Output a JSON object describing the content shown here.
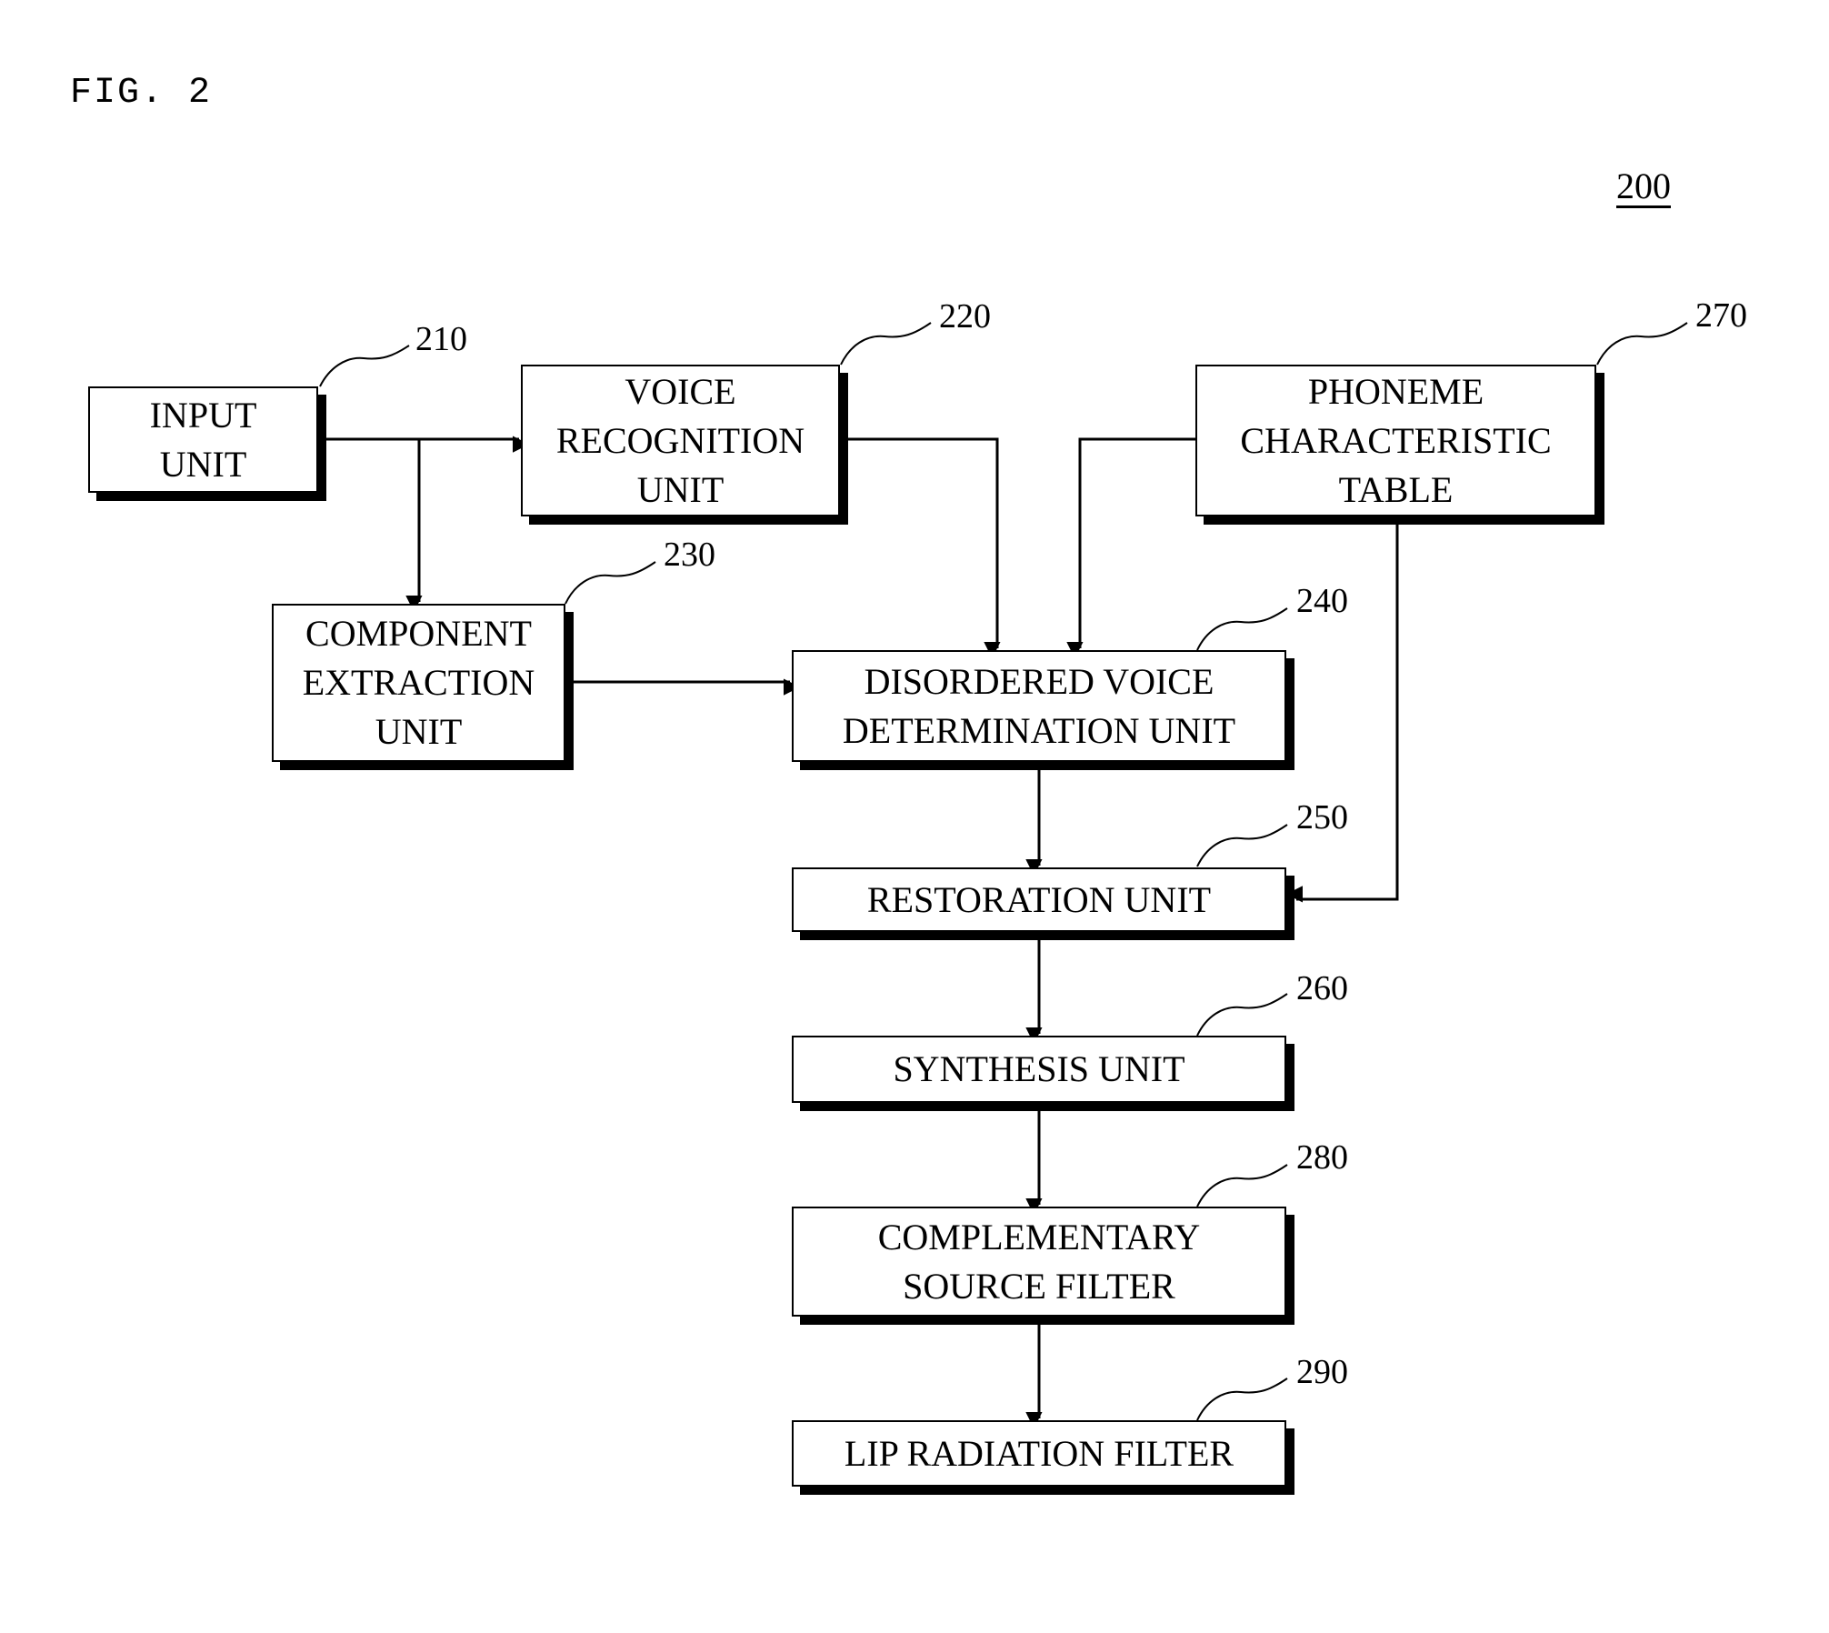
{
  "figure": {
    "title": "FIG. 2",
    "reference": "200"
  },
  "blocks": {
    "input": {
      "label": "INPUT\nUNIT",
      "ref": "210"
    },
    "voice_recognition": {
      "label": "VOICE\nRECOGNITION\nUNIT",
      "ref": "220"
    },
    "component_extraction": {
      "label": "COMPONENT\nEXTRACTION\nUNIT",
      "ref": "230"
    },
    "disordered_voice": {
      "label": "DISORDERED VOICE\nDETERMINATION UNIT",
      "ref": "240"
    },
    "restoration": {
      "label": "RESTORATION UNIT",
      "ref": "250"
    },
    "synthesis": {
      "label": "SYNTHESIS UNIT",
      "ref": "260"
    },
    "phoneme_table": {
      "label": "PHONEME\nCHARACTERISTIC\nTABLE",
      "ref": "270"
    },
    "complementary_filter": {
      "label": "COMPLEMENTARY\nSOURCE FILTER",
      "ref": "280"
    },
    "lip_filter": {
      "label": "LIP RADIATION FILTER",
      "ref": "290"
    }
  },
  "connections": [
    {
      "from": "input",
      "to": "voice_recognition"
    },
    {
      "from": "input",
      "to": "component_extraction"
    },
    {
      "from": "voice_recognition",
      "to": "disordered_voice"
    },
    {
      "from": "phoneme_table",
      "to": "disordered_voice"
    },
    {
      "from": "component_extraction",
      "to": "disordered_voice"
    },
    {
      "from": "disordered_voice",
      "to": "restoration"
    },
    {
      "from": "phoneme_table",
      "to": "restoration"
    },
    {
      "from": "restoration",
      "to": "synthesis"
    },
    {
      "from": "synthesis",
      "to": "complementary_filter"
    },
    {
      "from": "complementary_filter",
      "to": "lip_filter"
    }
  ]
}
